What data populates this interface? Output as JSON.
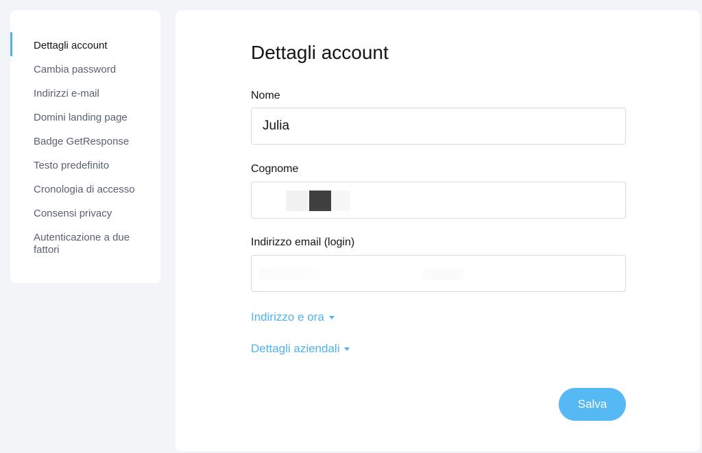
{
  "sidebar": {
    "items": [
      {
        "label": "Dettagli account"
      },
      {
        "label": "Cambia password"
      },
      {
        "label": "Indirizzi e-mail"
      },
      {
        "label": "Domini landing page"
      },
      {
        "label": "Badge GetResponse"
      },
      {
        "label": "Testo predefinito"
      },
      {
        "label": "Cronologia di accesso"
      },
      {
        "label": "Consensi privacy"
      },
      {
        "label": "Autenticazione a due fattori"
      }
    ]
  },
  "main": {
    "title": "Dettagli account",
    "fields": {
      "first_name": {
        "label": "Nome",
        "value": "Julia"
      },
      "last_name": {
        "label": "Cognome",
        "value": ""
      },
      "email": {
        "label": "Indirizzo email (login)",
        "value": ""
      }
    },
    "sections": {
      "address": "Indirizzo e ora",
      "company": "Dettagli aziendali"
    },
    "save_label": "Salva"
  },
  "colors": {
    "accent": "#4db3ef",
    "background": "#f3f4f7",
    "card": "#ffffff"
  }
}
